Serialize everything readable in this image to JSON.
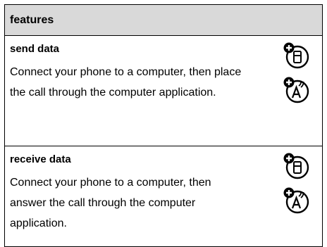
{
  "header": {
    "title": "features"
  },
  "rows": [
    {
      "title": "send data",
      "description": "Connect your phone to a computer, then place the call through the computer application.",
      "icons": [
        "phone-menu-icon",
        "voice-command-icon"
      ]
    },
    {
      "title": "receive data",
      "description": "Connect your phone to a computer, then answer the call through the computer application.",
      "icons": [
        "phone-menu-icon",
        "voice-command-icon"
      ]
    }
  ]
}
